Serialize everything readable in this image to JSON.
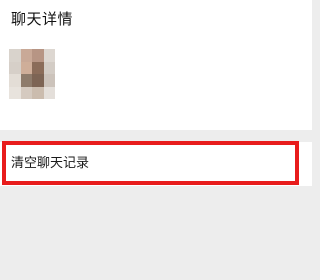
{
  "header": {
    "title": "聊天详情"
  },
  "members": [
    {
      "name_visible": false,
      "avatar": "pixelated-avatar"
    }
  ],
  "actions": {
    "clear_history_label": "清空聊天记录"
  },
  "colors": {
    "page_background": "#ededed",
    "panel_background": "#ffffff",
    "highlight": "#e81c1c"
  }
}
